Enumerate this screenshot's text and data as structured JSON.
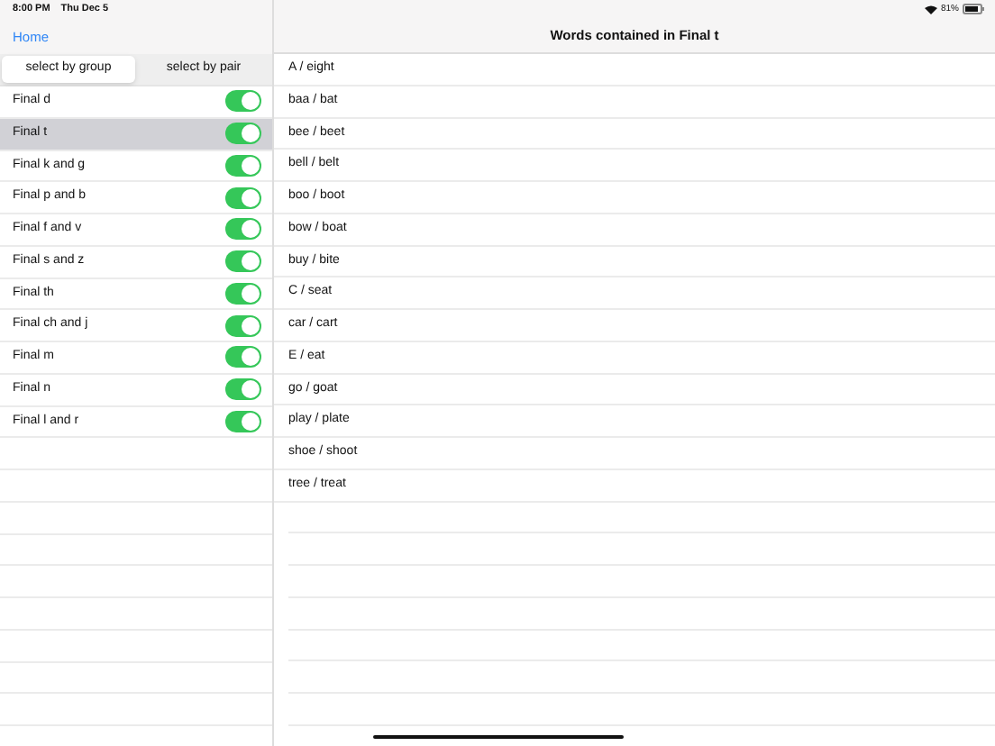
{
  "status_bar": {
    "time": "8:00 PM",
    "date": "Thu Dec 5",
    "battery": "81%"
  },
  "nav": {
    "back": "Home",
    "title": "Words contained in Final t"
  },
  "segments": [
    {
      "label": "select by group",
      "selected": true
    },
    {
      "label": "select by pair",
      "selected": false
    }
  ],
  "groups": [
    {
      "label": "Final d",
      "on": true,
      "selected": false
    },
    {
      "label": "Final t",
      "on": true,
      "selected": true
    },
    {
      "label": "Final k and g",
      "on": true,
      "selected": false
    },
    {
      "label": "Final p and b",
      "on": true,
      "selected": false
    },
    {
      "label": "Final f and v",
      "on": true,
      "selected": false
    },
    {
      "label": "Final s and z",
      "on": true,
      "selected": false
    },
    {
      "label": "Final th",
      "on": true,
      "selected": false
    },
    {
      "label": "Final ch and j",
      "on": true,
      "selected": false
    },
    {
      "label": "Final m",
      "on": true,
      "selected": false
    },
    {
      "label": "Final n",
      "on": true,
      "selected": false
    },
    {
      "label": "Final l and r",
      "on": true,
      "selected": false
    }
  ],
  "words": [
    "A / eight",
    "baa / bat",
    "bee / beet",
    "bell / belt",
    "boo / boot",
    "bow / boat",
    "buy / bite",
    "C / seat",
    "car / cart",
    "E / eat",
    "go / goat",
    "play / plate",
    "shoe / shoot",
    "tree / treat"
  ]
}
